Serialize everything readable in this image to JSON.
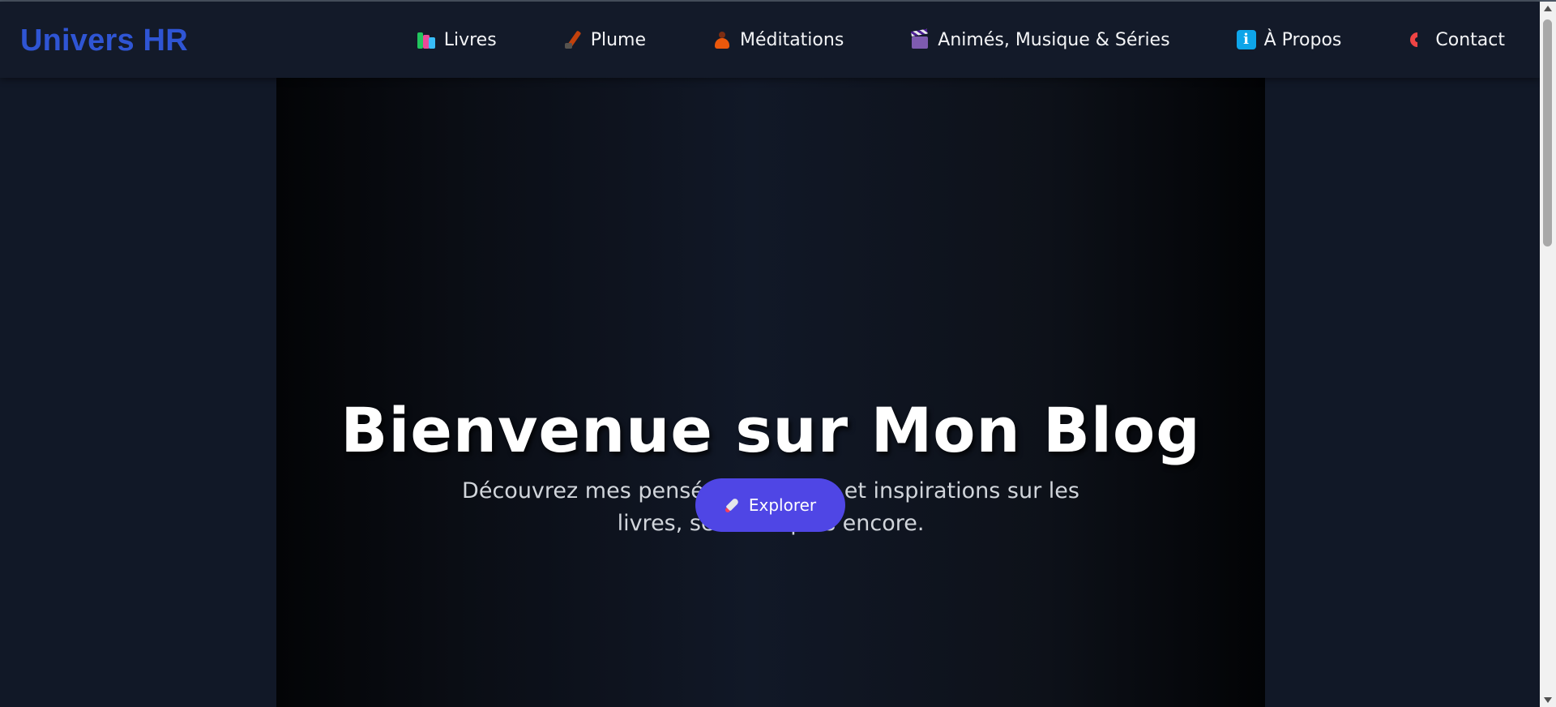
{
  "header": {
    "brand": "Univers HR",
    "nav": [
      {
        "label": "Livres",
        "icon": "books-icon"
      },
      {
        "label": "Plume",
        "icon": "pen-icon"
      },
      {
        "label": "Méditations",
        "icon": "meditation-icon"
      },
      {
        "label": "Animés, Musique & Séries",
        "icon": "clapper-board-icon"
      },
      {
        "label": "À Propos",
        "icon": "info-icon"
      },
      {
        "label": "Contact",
        "icon": "phone-icon"
      }
    ]
  },
  "hero": {
    "title": "Bienvenue sur Mon Blog",
    "subtitle": "Découvrez mes pensées, critiques et inspirations sur les livres, séries et plus encore.",
    "cta_label": "Explorer",
    "cta_icon": "rocket-icon"
  },
  "colors": {
    "page_bg": "#111827",
    "navbar_bg": "#131a29",
    "brand": "#2f55d4",
    "cta_bg": "#4f46e5"
  }
}
